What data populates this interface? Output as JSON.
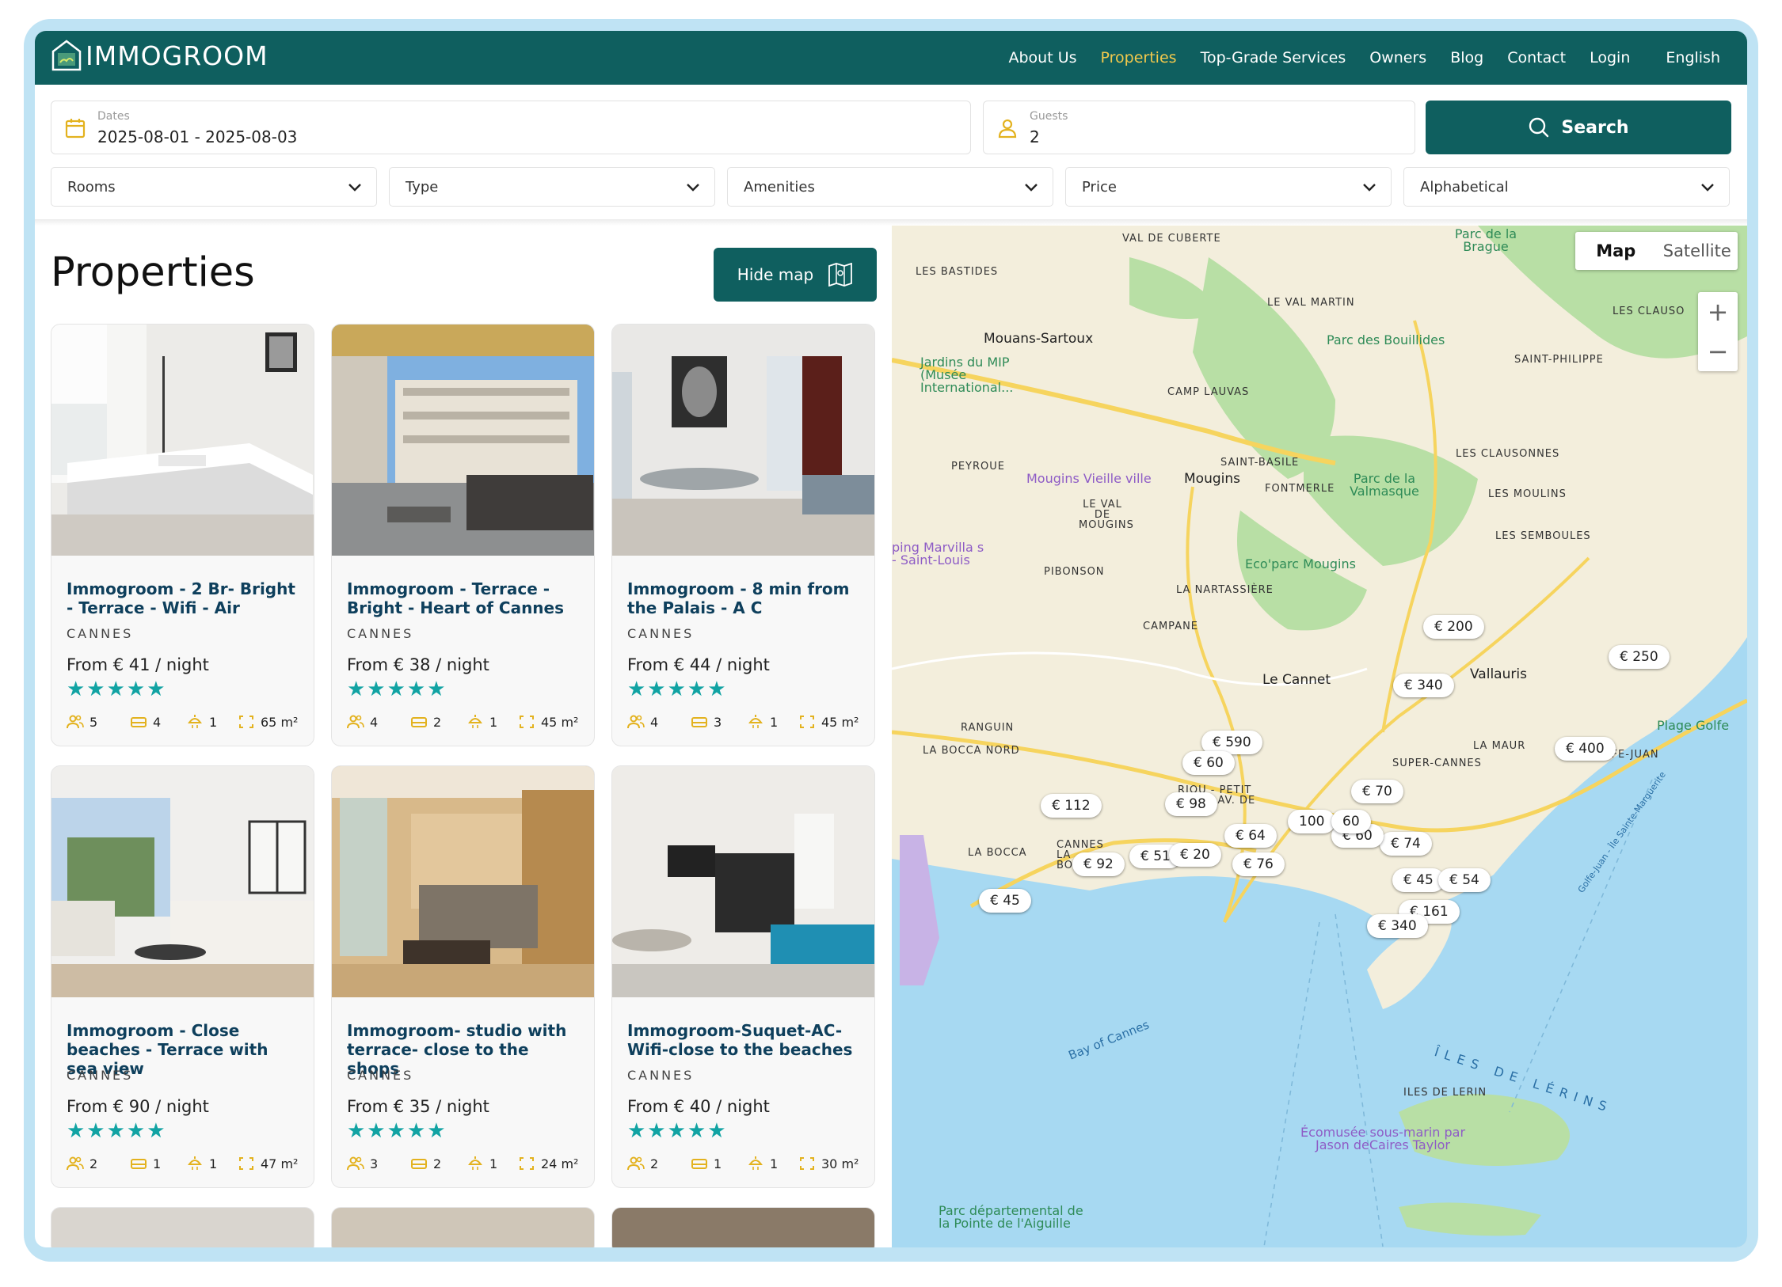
{
  "app": {
    "brand": "IMMOGROOM"
  },
  "nav": {
    "items": [
      "About Us",
      "Properties",
      "Top-Grade Services",
      "Owners",
      "Blog",
      "Contact",
      "Login"
    ],
    "active": "Properties",
    "language": "English"
  },
  "search": {
    "dates_label": "Dates",
    "dates_value": "2025-08-01 - 2025-08-03",
    "guests_label": "Guests",
    "guests_value": "2",
    "button": "Search",
    "accent": "#0f5f5f",
    "icon_color": "#e3b21f"
  },
  "filters": [
    "Rooms",
    "Type",
    "Amenities",
    "Price",
    "Alphabetical"
  ],
  "page": {
    "title": "Properties",
    "hide_map": "Hide map"
  },
  "cards": [
    {
      "title": "Immogroom - 2 Br- Bright - Terrace - Wifi - Air",
      "city": "CANNES",
      "price": "From € 41 / night",
      "stars": "★★★★★",
      "guests": "5",
      "bedrooms": "4",
      "bathrooms": "1",
      "area": "65 m²"
    },
    {
      "title": "Immogroom - Terrace - Bright - Heart of Cannes",
      "city": "CANNES",
      "price": "From € 38 / night",
      "stars": "★★★★★",
      "guests": "4",
      "bedrooms": "2",
      "bathrooms": "1",
      "area": "45 m²"
    },
    {
      "title": "Immogroom - 8 min from the Palais - A C",
      "city": "CANNES",
      "price": "From € 44 / night",
      "stars": "★★★★★",
      "guests": "4",
      "bedrooms": "3",
      "bathrooms": "1",
      "area": "45 m²"
    },
    {
      "title": "Immogroom - Close beaches - Terrace with sea view",
      "city": "CANNES",
      "price": "From € 90 / night",
      "stars": "★★★★★",
      "guests": "2",
      "bedrooms": "1",
      "bathrooms": "1",
      "area": "47 m²"
    },
    {
      "title": "Immogroom- studio with terrace- close to the shops",
      "city": "CANNES",
      "price": "From € 35 / night",
      "stars": "★★★★★",
      "guests": "3",
      "bedrooms": "2",
      "bathrooms": "1",
      "area": "24 m²"
    },
    {
      "title": "Immogroom-Suquet-AC-Wifi-close to the beaches",
      "city": "CANNES",
      "price": "From € 40 / night",
      "stars": "★★★★★",
      "guests": "2",
      "bedrooms": "1",
      "bathrooms": "1",
      "area": "30 m²"
    }
  ],
  "map": {
    "tabs": [
      "Map",
      "Satellite"
    ],
    "active_tab": "Map",
    "zoom_in": "+",
    "zoom_out": "−",
    "pins": [
      "€ 200",
      "€ 250",
      "€ 340",
      "€ 590",
      "€ 60",
      "€ 400",
      "€ 70",
      "€ 112",
      "€ 98",
      "€ 51",
      "€ 92",
      "€ 76",
      "€ 45",
      "€ 74",
      "€ 45",
      "€ 54",
      "€ 161",
      "€ 340",
      "€ 60",
      "€ 20",
      "€ 64",
      "100",
      "60"
    ],
    "labels": {
      "districts": [
        "VAL DE CUBERTE",
        "LES BASTIDES",
        "LE VAL MARTIN",
        "LES CLAUSO",
        "SAINT-PHILIPPE",
        "CAMP LAUVAS",
        "PEYROUE",
        "SAINT-BASILE",
        "FONTMERLE",
        "LE VAL DE MOUGINS",
        "LES CLAUSONNES",
        "LES MOULINS",
        "LES SEMBOULES",
        "PIBONSON",
        "LA NARTASSIÈRE",
        "CAMPANE",
        "RANGUIN",
        "LA BOCCA NORD",
        "LA MAUR",
        "SUPER-CANNES",
        "GOLFE-JUAN",
        "LA BOCCA",
        "CANNES LA BOCCA",
        "RIOU - PETIT JUAS - AV. DE",
        "ILES DE LERIN"
      ],
      "cities": [
        "Mouans-Sartoux",
        "Mougins",
        "Le Cannet",
        "Vallauris"
      ],
      "parks": [
        "Parc de la Brague",
        "Parc des Bouillides",
        "Jardins du MIP (Musée International...",
        "Parc de la Valmasque",
        "Eco'parc Mougins",
        "Plage Golfe",
        "Parc départemental de la Pointe de l'Aiguille"
      ],
      "venues": [
        "Mougins Vieille ville",
        "ping Marvilla s - Saint-Louis",
        "Écomusée sous-marin par Jason deCaires Taylor"
      ],
      "water": [
        "Bay of Cannes",
        "ÎLES DE LÉRINS",
        "Golfe-Juan - Île Sainte-Marguerite"
      ]
    },
    "colors": {
      "land": "#f3eedc",
      "sea": "#a7d9f2",
      "green": "#9fd79a",
      "road": "#f6d45e",
      "purple": "#b59ad9"
    }
  }
}
